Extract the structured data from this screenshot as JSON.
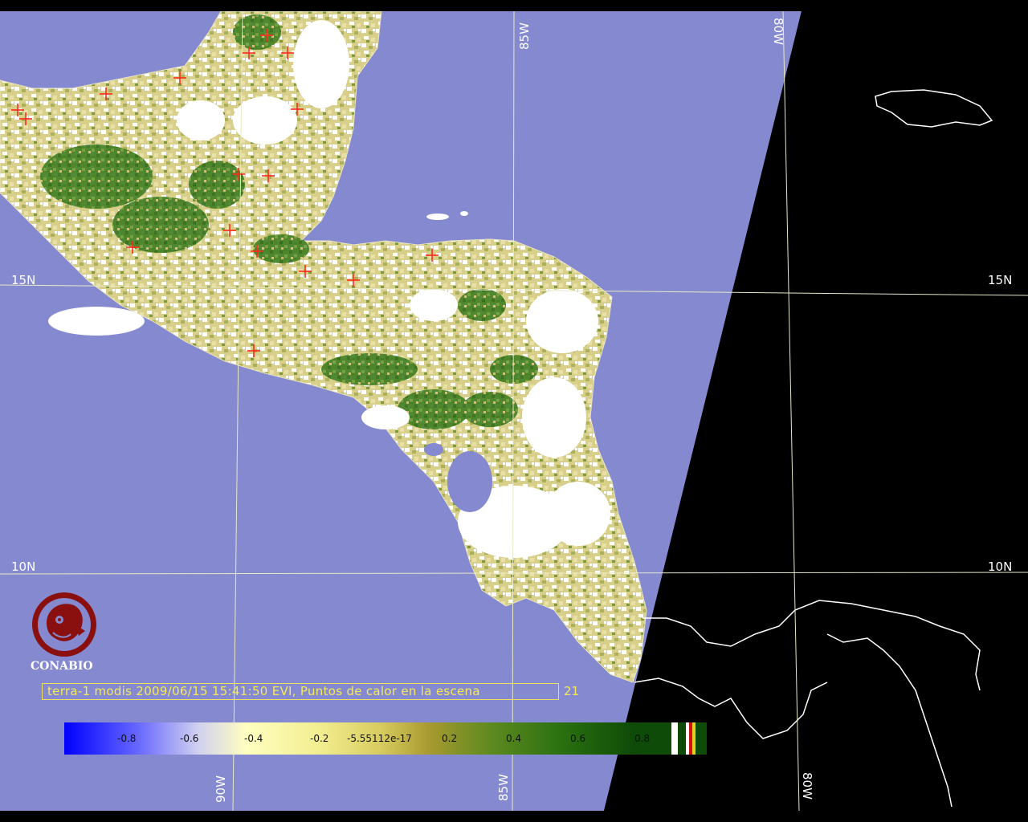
{
  "map": {
    "grid_labels": {
      "lat_15_left": "15N",
      "lat_15_right": "15N",
      "lat_10_left": "10N",
      "lat_10_right": "10N",
      "lon_85_top": "85W",
      "lon_80_top": "80W",
      "lon_90_bottom": "90W",
      "lon_85_bottom": "85W",
      "lon_80_bottom": "80W"
    },
    "caption": "terra-1 modis 2009/06/15 15:41:50 EVI, Puntos de calor en la escena",
    "hotspot_count": "21",
    "logo_text": "CONABIO",
    "colors": {
      "water": "#8589cf",
      "no_data": "#000000",
      "grid": "#e8e8c8",
      "coast": "#ffffff",
      "hotspot": "#ff2a1a",
      "caption": "#f5e95a"
    },
    "colorbar": {
      "ticks": [
        "-0.8",
        "-0.6",
        "-0.4",
        "-0.2",
        "-5.55112e-17",
        "0.2",
        "0.4",
        "0.6",
        "0.8"
      ]
    }
  }
}
